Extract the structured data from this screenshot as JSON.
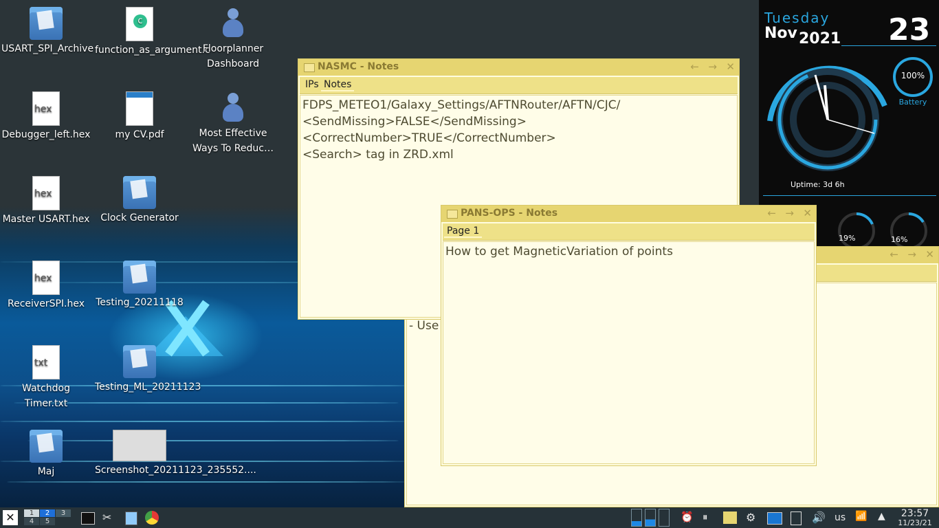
{
  "desktop": {
    "icons": [
      {
        "label": "USART_SPI_Archive",
        "kind": "folder"
      },
      {
        "label": "function_as_argument.c",
        "kind": "c-file"
      },
      {
        "label": "Floorplanner Dashboard",
        "kind": "app"
      },
      {
        "label": "Debugger_left.hex",
        "kind": "hex"
      },
      {
        "label": "my CV.pdf",
        "kind": "pdf"
      },
      {
        "label": "Most Effective Ways To Reduc…",
        "kind": "app"
      },
      {
        "label": "Master USART.hex",
        "kind": "hex"
      },
      {
        "label": "Clock Generator",
        "kind": "folder"
      },
      {
        "label": "ReceiverSPI.hex",
        "kind": "hex"
      },
      {
        "label": "Testing_20211118",
        "kind": "folder"
      },
      {
        "label": "Watchdog Timer.txt",
        "kind": "txt"
      },
      {
        "label": "Testing_ML_20211123",
        "kind": "folder"
      },
      {
        "label": "Maj",
        "kind": "folder"
      },
      {
        "label": "Screenshot_20211123_235552....",
        "kind": "image"
      }
    ],
    "file_badges": {
      "hex": "hex",
      "txt": "txt",
      "c": "c"
    }
  },
  "windows": {
    "nasmc": {
      "title": "NASMC - Notes",
      "tabs": [
        "IPs",
        "Notes"
      ],
      "active_tab": "Notes",
      "lines": [
        "FDPS_METEO1/Galaxy_Settings/AFTNRouter/AFTN/CJC/",
        "<SendMissing>FALSE</SendMissing>",
        "<CorrectNumber>TRUE</CorrectNumber>",
        "<Search> tag in ZRD.xml"
      ]
    },
    "pansops": {
      "title": "PANS-OPS - Notes",
      "tabs": [
        "Page 1"
      ],
      "lines": [
        "How to get MagneticVariation of points"
      ]
    },
    "third": {
      "visible_text": "- Use"
    },
    "buttons": {
      "back": "←",
      "forward": "→",
      "close": "✕"
    }
  },
  "widget": {
    "weekday": "Tuesday",
    "month": "Nov",
    "year": "2021",
    "day": "23",
    "battery_percent": "100%",
    "battery_label": "Battery",
    "uptime": "Uptime: 3d 6h",
    "cpu1_percent": "19%",
    "cpu2_percent": "16%",
    "battery_level": 1.0,
    "cpu1_level": 0.19,
    "cpu2_level": 0.16,
    "accent_color": "#2aa7e0"
  },
  "taskbar": {
    "workspaces": [
      "1",
      "2",
      "3",
      "4",
      "5"
    ],
    "active_workspace": "2",
    "keyboard_layout": "us",
    "time": "23:57",
    "date": "11/23/21"
  }
}
